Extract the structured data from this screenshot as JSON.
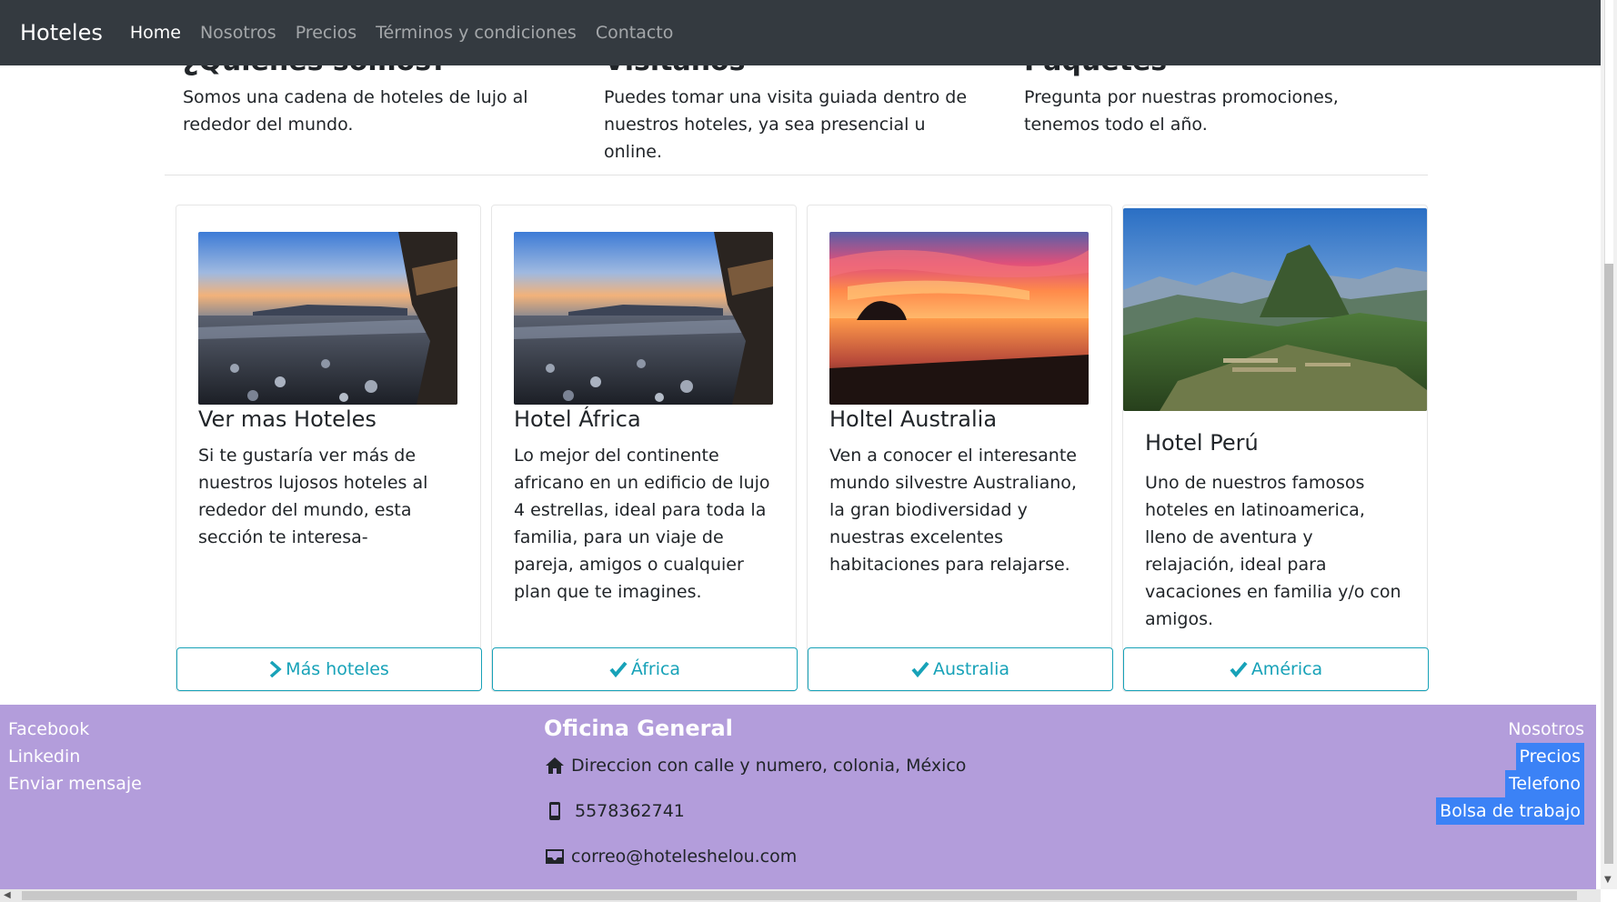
{
  "navbar": {
    "brand": "Hoteles",
    "items": [
      {
        "label": "Home",
        "active": true
      },
      {
        "label": "Nosotros"
      },
      {
        "label": "Precios"
      },
      {
        "label": "Términos y condiciones"
      },
      {
        "label": "Contacto"
      }
    ]
  },
  "intro": [
    {
      "title": "¿Quiénes somos?",
      "text": "Somos una cadena de hoteles de lujo al rededor del mundo."
    },
    {
      "title": "Visitanos",
      "text": "Puedes tomar una visita guiada dentro de nuestros hoteles, ya sea presencial u online."
    },
    {
      "title": "Paquetes",
      "text": "Pregunta por nuestras promociones, tenemos todo el año."
    }
  ],
  "cards": [
    {
      "title": "Ver mas Hoteles",
      "text": "Si te gustaría ver más de nuestros lujosos hoteles al rededor del mundo, esta sección te interesa-",
      "button": "Más hoteles",
      "button_icon": "chevron-right-icon",
      "image": "rocky-beach-image"
    },
    {
      "title": "Hotel África",
      "text": "Lo mejor del continente africano en un edificio de lujo 4 estrellas, ideal para toda la familia, para un viaje de pareja, amigos o cualquier plan que te imagines.",
      "button": " África",
      "button_icon": "check-icon",
      "image": "rocky-beach-image"
    },
    {
      "title": "Holtel Australia",
      "text": "Ven a conocer el interesante mundo silvestre Australiano, la gran biodiversidad y nuestras excelentes habitaciones para relajarse.",
      "button": "Australia",
      "button_icon": "check-icon",
      "image": "sunset-beach-image"
    },
    {
      "title": "Hotel Perú",
      "text": "Uno de nuestros famosos hoteles en latinoamerica, lleno de aventura y relajación, ideal para vacaciones en familia y/o con amigos.",
      "button": "América",
      "button_icon": "check-icon",
      "image": "machu-picchu-image"
    }
  ],
  "footer": {
    "social": [
      "Facebook",
      "Linkedin",
      "Enviar mensaje"
    ],
    "office_heading": "Oficina General",
    "address": "Direccion con calle y numero, colonia, México",
    "phone": "5578362741",
    "email": "correo@hoteleshelou.com",
    "links": [
      "Nosotros",
      "Precios",
      "Telefono",
      "Bolsa de trabajo"
    ]
  },
  "colors": {
    "navbar_bg": "#343a40",
    "footer_bg": "#b39ddb",
    "accent": "#17a2b8",
    "selection": "#3b82f6"
  }
}
